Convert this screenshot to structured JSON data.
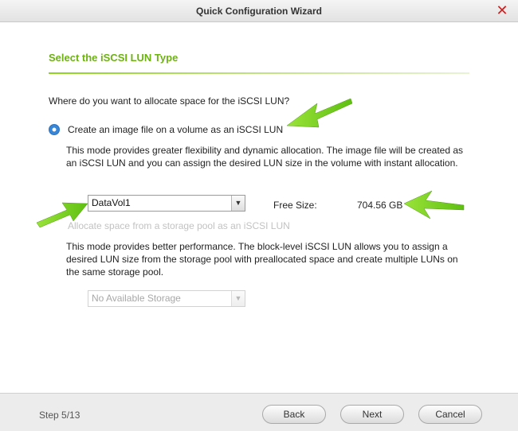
{
  "window": {
    "title": "Quick Configuration Wizard"
  },
  "section": {
    "title": "Select the iSCSI LUN Type"
  },
  "question": "Where do you want to allocate space for the iSCSI LUN?",
  "option_image_file": {
    "label": "Create an image file on a volume as an iSCSI LUN",
    "description": "This mode provides greater flexibility and dynamic allocation. The image file will be created as an iSCSI LUN and you can assign the desired LUN size in the volume with instant allocation.",
    "selected": true,
    "volume_select": {
      "value": "DataVol1"
    },
    "free_size_label": "Free Size:",
    "free_size_value": "704.56 GB"
  },
  "option_storage_pool": {
    "label": "Allocate space from a storage pool as an iSCSI LUN",
    "description": "This mode provides better performance. The block-level iSCSI LUN allows you to assign a desired LUN size from the storage pool with preallocated space and create multiple LUNs on the same storage pool.",
    "selected": false,
    "pool_select": {
      "value": "No Available Storage"
    }
  },
  "footer": {
    "step": "Step 5/13",
    "back_label": "Back",
    "next_label": "Next",
    "cancel_label": "Cancel"
  },
  "colors": {
    "accent": "#6cb210",
    "radio": "#3a86d6",
    "close": "#d21f1f",
    "annotation_arrow": "#7ed321"
  }
}
